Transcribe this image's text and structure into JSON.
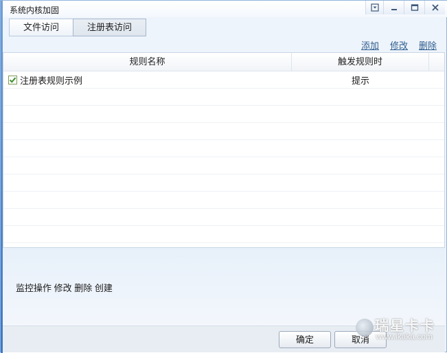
{
  "window": {
    "title": "系统内核加固",
    "controls": [
      "menu-icon",
      "minimize-icon",
      "maximize-icon",
      "close-icon"
    ]
  },
  "tabs": [
    {
      "label": "文件访问",
      "active": false
    },
    {
      "label": "注册表访问",
      "active": true
    }
  ],
  "actions": {
    "add": "添加",
    "edit": "修改",
    "delete": "删除"
  },
  "table": {
    "columns": [
      "规则名称",
      "触发规则时"
    ],
    "rows": [
      {
        "checked": true,
        "name": "注册表规则示例",
        "trigger": "提示"
      }
    ]
  },
  "description": "监控操作 修改 删除 创建",
  "buttons": {
    "ok": "确定",
    "cancel": "取消"
  },
  "watermark": {
    "main": "瑞星卡卡",
    "sub": "www.ikaka.com"
  },
  "colors": {
    "accent": "#2f5d8f",
    "window_border": "#8fb3db",
    "checkbox_green": "#3a8f2a"
  }
}
